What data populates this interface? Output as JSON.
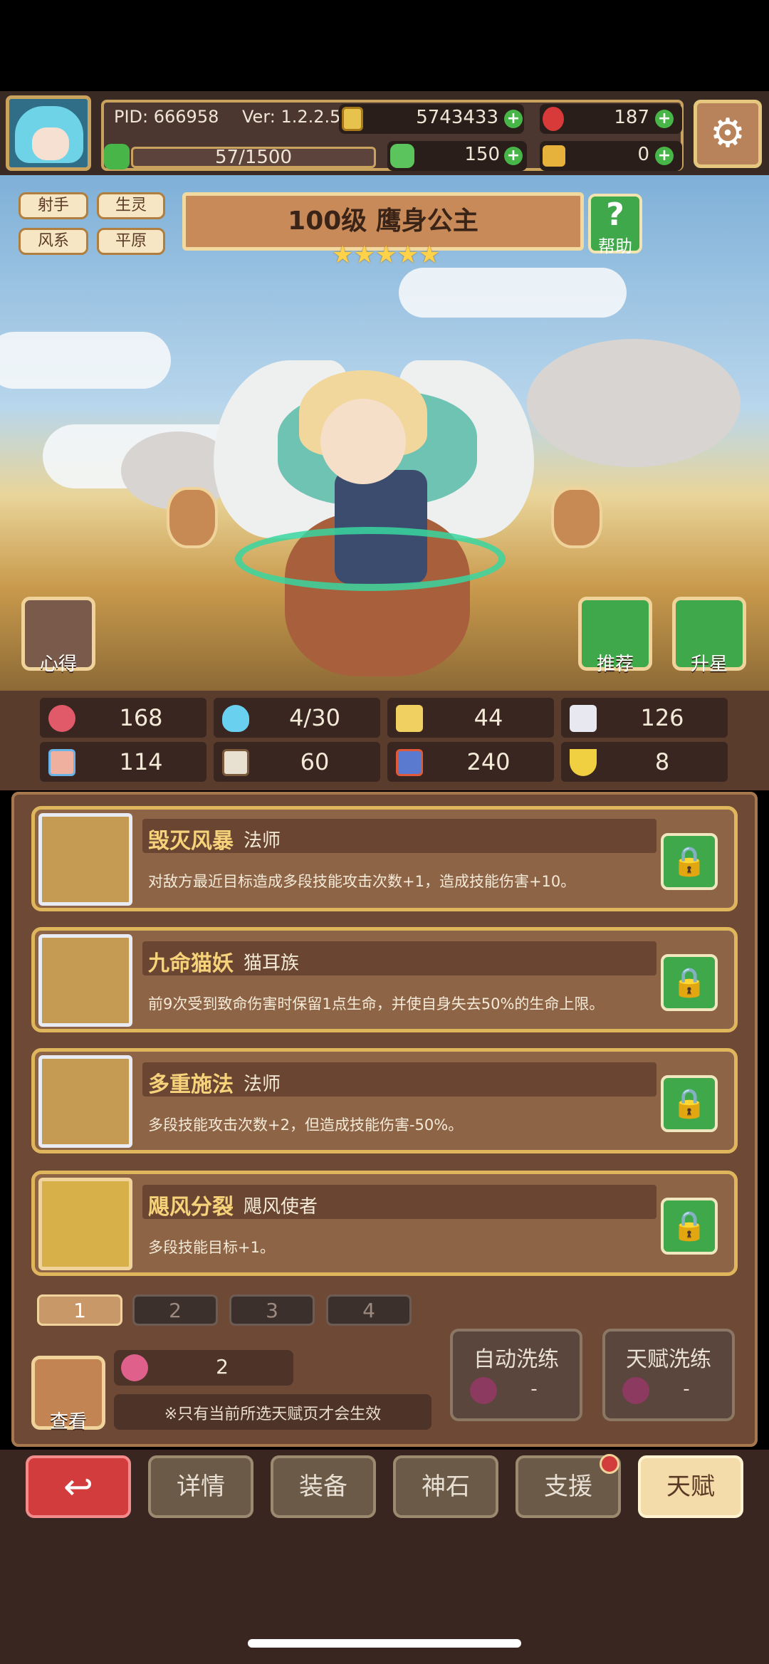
{
  "header": {
    "pid": "PID: 666958",
    "version": "Ver: 1.2.2.5",
    "gold": "5743433",
    "gems": "187",
    "energy": "57/1500",
    "clover": "150",
    "horn": "0"
  },
  "hero": {
    "tags": [
      "射手",
      "生灵",
      "风系",
      "平原"
    ],
    "title": "100级  鹰身公主",
    "stars": "★★★★★",
    "help_label": "帮助",
    "help_glyph": "?",
    "mind_label": "心得",
    "recommend_label": "推荐",
    "starup_label": "升星"
  },
  "stats": {
    "hp": "168",
    "mana": "4/30",
    "defense": "44",
    "speed": "126",
    "attack": "114",
    "magic": "60",
    "power": "240",
    "luck": "8"
  },
  "talents": [
    {
      "name": "毁灭风暴",
      "class": "法师",
      "desc": "对敌方最近目标造成多段技能攻击次数+1，造成技能伤害+10。"
    },
    {
      "name": "九命猫妖",
      "class": "猫耳族",
      "desc": "前9次受到致命伤害时保留1点生命，并使自身失去50%的生命上限。"
    },
    {
      "name": "多重施法",
      "class": "法师",
      "desc": "多段技能攻击次数+2，但造成技能伤害-50%。"
    },
    {
      "name": "飓风分裂",
      "class": "飓风使者",
      "desc": "多段技能目标+1。"
    }
  ],
  "pages": [
    "1",
    "2",
    "3",
    "4"
  ],
  "controls": {
    "view_label": "查看",
    "potion_count": "2",
    "note": "※只有当前所选天赋页才会生效",
    "auto_wash_label": "自动洗练",
    "auto_wash_cost": "-",
    "talent_wash_label": "天赋洗练",
    "talent_wash_cost": "-"
  },
  "nav": {
    "back": "↩",
    "details": "详情",
    "equipment": "装备",
    "god_stone": "神石",
    "support": "支援",
    "talent": "天赋"
  }
}
